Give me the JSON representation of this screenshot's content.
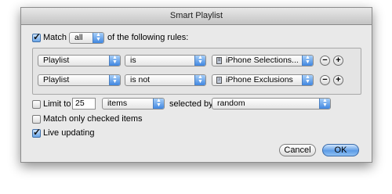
{
  "window": {
    "title": "Smart Playlist"
  },
  "match": {
    "checkbox_label": "Match",
    "checked": true,
    "selector_value": "all",
    "suffix": "of the following rules:"
  },
  "rules": [
    {
      "field": "Playlist",
      "operator": "is",
      "value": "iPhone Selections...",
      "value_icon": "playlist-icon"
    },
    {
      "field": "Playlist",
      "operator": "is not",
      "value": "iPhone Exclusions",
      "value_icon": "playlist-icon"
    }
  ],
  "rule_buttons": {
    "remove": "−",
    "add": "+"
  },
  "limit": {
    "label": "Limit to",
    "checked": false,
    "amount": "25",
    "unit": "items",
    "selected_by_label": "selected by",
    "selected_by": "random"
  },
  "match_checked": {
    "label": "Match only checked items",
    "checked": false
  },
  "live_updating": {
    "label": "Live updating",
    "checked": true
  },
  "buttons": {
    "cancel": "Cancel",
    "ok": "OK"
  }
}
